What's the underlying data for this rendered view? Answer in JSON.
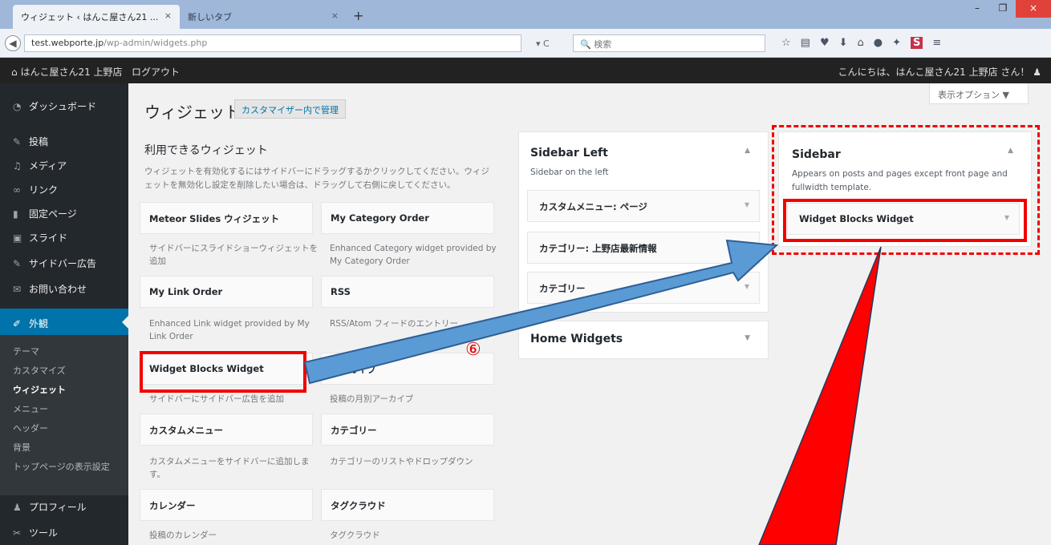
{
  "browser": {
    "active_tab": "ウィジェット ‹ はんこ屋さん21 ...",
    "active_tab_close": "×",
    "second_tab": "新しいタブ",
    "second_tab_close": "×",
    "new_tab": "+",
    "url_domain": "test.webporte.jp",
    "url_path": "/wp-admin/widgets.php",
    "search_placeholder": "検索",
    "win_min": "–",
    "win_max": "❐",
    "win_close": "×"
  },
  "admin_bar": {
    "site": "はんこ屋さん21 上野店",
    "logout": "ログアウト",
    "greeting": "こんにちは、はんこ屋さん21 上野店 さん！"
  },
  "sidebar": {
    "items": [
      {
        "label": "ダッシュボード",
        "icon": "dashboard-icon"
      },
      {
        "label": "投稿",
        "icon": "pin-icon"
      },
      {
        "label": "メディア",
        "icon": "media-icon"
      },
      {
        "label": "リンク",
        "icon": "link-icon"
      },
      {
        "label": "固定ページ",
        "icon": "page-icon"
      },
      {
        "label": "スライド",
        "icon": "slide-icon"
      },
      {
        "label": "サイドバー広告",
        "icon": "pin-icon"
      },
      {
        "label": "お問い合わせ",
        "icon": "mail-icon"
      },
      {
        "label": "外観",
        "icon": "brush-icon"
      }
    ],
    "submenu": [
      "テーマ",
      "カスタマイズ",
      "ウィジェット",
      "メニュー",
      "ヘッダー",
      "背景",
      "トップページの表示設定"
    ],
    "bottom": [
      {
        "label": "プロフィール",
        "icon": "user-icon"
      },
      {
        "label": "ツール",
        "icon": "wrench-icon"
      }
    ]
  },
  "main": {
    "screen_options": "表示オプション ▼",
    "title": "ウィジェット",
    "customizer_button": "カスタマイザー内で管理",
    "available_title": "利用できるウィジェット",
    "available_desc": "ウィジェットを有効化するにはサイドバーにドラッグするかクリックしてください。ウィジェットを無効化し設定を削除したい場合は、ドラッグして右側に戻してください。",
    "widgets": [
      {
        "title": "Meteor Slides ウィジェット",
        "desc": "サイドバーにスライドショーウィジェットを追加"
      },
      {
        "title": "My Category Order",
        "desc": "Enhanced Category widget provided by My Category Order"
      },
      {
        "title": "My Link Order",
        "desc": "Enhanced Link widget provided by My Link Order"
      },
      {
        "title": "RSS",
        "desc": "RSS/Atom フィードのエントリー"
      },
      {
        "title": "Widget Blocks Widget",
        "desc": "サイドバーにサイドバー広告を追加"
      },
      {
        "title": "アーカイブ",
        "desc": "投稿の月別アーカイブ"
      },
      {
        "title": "カスタムメニュー",
        "desc": "カスタムメニューをサイドバーに追加します。"
      },
      {
        "title": "カテゴリー",
        "desc": "カテゴリーのリストやドロップダウン"
      },
      {
        "title": "カレンダー",
        "desc": "投稿のカレンダー"
      },
      {
        "title": "タグクラウド",
        "desc": "タグクラウド"
      }
    ]
  },
  "sidebar_left": {
    "title": "Sidebar Left",
    "desc": "Sidebar on the left",
    "widgets": [
      "カスタムメニュー: ページ",
      "カテゴリー: 上野店最新情報",
      "カテゴリー"
    ]
  },
  "home_widgets": {
    "title": "Home Widgets"
  },
  "sidebar_right": {
    "title": "Sidebar",
    "desc": "Appears on posts and pages except front page and fullwidth template.",
    "widget": "Widget Blocks Widget"
  },
  "annotation": {
    "step": "⑥"
  },
  "colors": {
    "accent": "#0073aa",
    "highlight": "#f20000",
    "arrow": "#5b9bd5"
  }
}
